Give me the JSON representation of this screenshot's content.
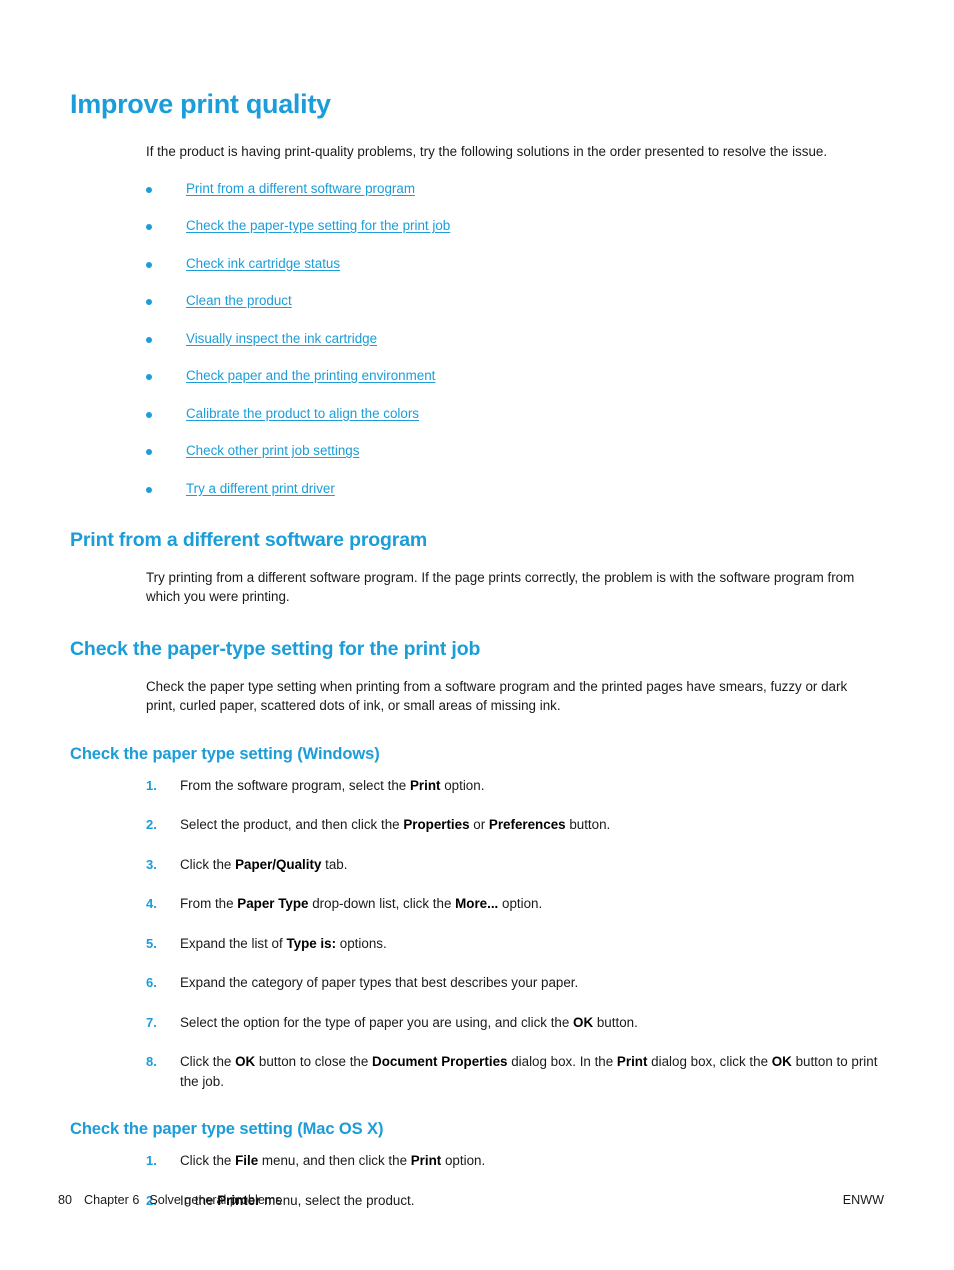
{
  "page": {
    "title": "Improve print quality",
    "intro": "If the product is having print-quality problems, try the following solutions in the order presented to resolve the issue."
  },
  "toc_links": [
    {
      "label": "Print from a different software program"
    },
    {
      "label": "Check the paper-type setting for the print job"
    },
    {
      "label": "Check ink cartridge status"
    },
    {
      "label": "Clean the product"
    },
    {
      "label": "Visually inspect the ink cartridge"
    },
    {
      "label": "Check paper and the printing environment"
    },
    {
      "label": "Calibrate the product to align the colors"
    },
    {
      "label": "Check other print job settings"
    },
    {
      "label": "Try a different print driver"
    }
  ],
  "sections": [
    {
      "heading": "Print from a different software program",
      "body": "Try printing from a different software program. If the page prints correctly, the problem is with the software program from which you were printing."
    },
    {
      "heading": "Check the paper-type setting for the print job",
      "body": "Check the paper type setting when printing from a software program and the printed pages have smears, fuzzy or dark print, curled paper, scattered dots of ink, or small areas of missing ink."
    }
  ],
  "windows_procedure": {
    "heading": "Check the paper type setting (Windows)",
    "steps": [
      {
        "num": "1.",
        "html": "From the software program, select the <b>Print</b> option."
      },
      {
        "num": "2.",
        "html": "Select the product, and then click the <b>Properties</b> or <b>Preferences</b> button."
      },
      {
        "num": "3.",
        "html": "Click the <b>Paper/Quality</b> tab."
      },
      {
        "num": "4.",
        "html": "From the <b>Paper Type</b> drop-down list, click the <b>More...</b> option."
      },
      {
        "num": "5.",
        "html": "Expand the list of <b>Type is:</b> options."
      },
      {
        "num": "6.",
        "html": "Expand the category of paper types that best describes your paper."
      },
      {
        "num": "7.",
        "html": "Select the option for the type of paper you are using, and click the <b>OK</b> button."
      },
      {
        "num": "8.",
        "html": "Click the <b>OK</b> button to close the <b>Document Properties</b> dialog box. In the <b>Print</b> dialog box, click the <b>OK</b> button to print the job."
      }
    ]
  },
  "mac_procedure": {
    "heading": "Check the paper type setting (Mac OS X)",
    "steps": [
      {
        "num": "1.",
        "html": "Click the <b>File</b> menu, and then click the <b>Print</b> option."
      },
      {
        "num": "2.",
        "html": "In the <b>Printer</b> menu, select the product."
      }
    ]
  },
  "footer": {
    "page_number": "80",
    "chapter": "Chapter 6",
    "chapter_title": "Solve general problems",
    "locale": "ENWW"
  },
  "colors": {
    "accent_blue": "#1a9dd9",
    "body_text": "#1a1a1a",
    "background": "#ffffff"
  }
}
